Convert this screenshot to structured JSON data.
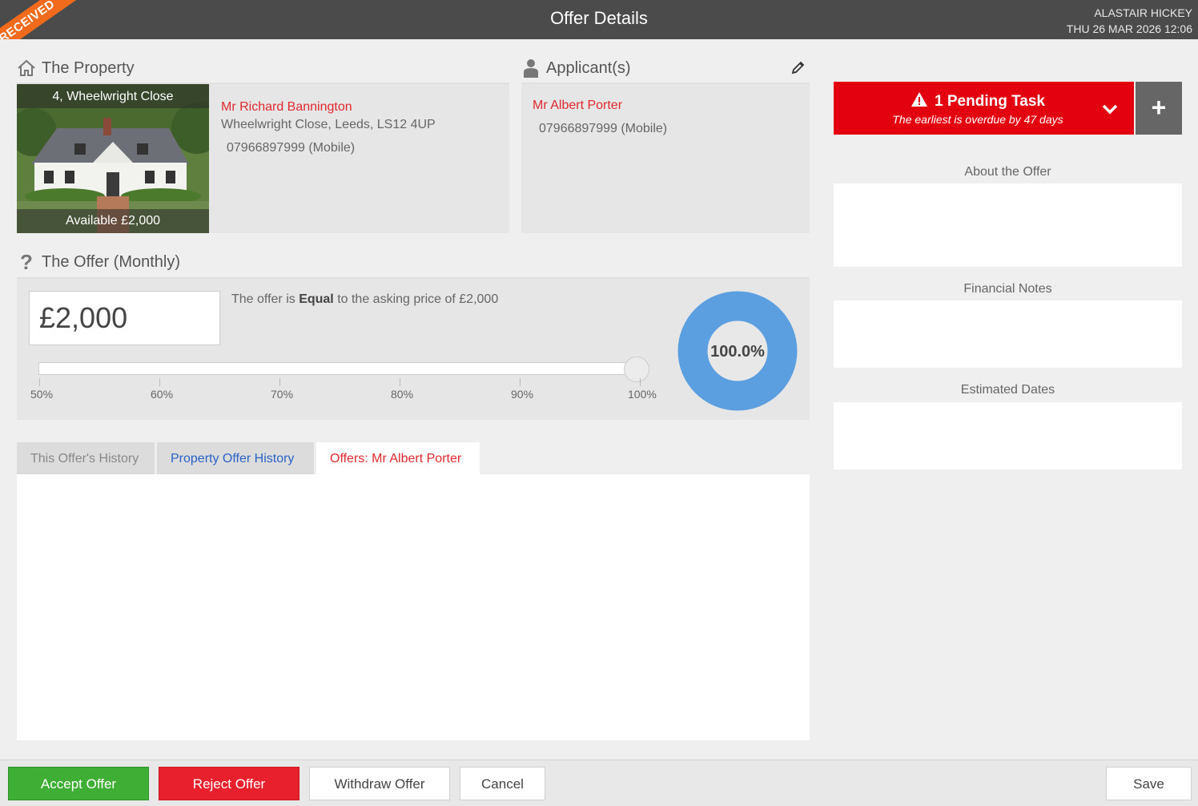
{
  "header": {
    "title": "Offer Details",
    "status_ribbon": "RECEIVED",
    "user_name": "ALASTAIR HICKEY",
    "datetime": "THU 26 MAR 2026 12:06"
  },
  "property": {
    "heading": "The Property",
    "address_caption": "4, Wheelwright Close",
    "availability_caption": "Available £2,000",
    "owner_name": "Mr Richard Bannington",
    "owner_address": "Wheelwright Close, Leeds, LS12 4UP",
    "owner_phone": "07966897999 (Mobile)"
  },
  "applicants": {
    "heading": "Applicant(s)",
    "name": "Mr Albert Porter",
    "phone": "07966897999 (Mobile)"
  },
  "offer": {
    "heading": "The Offer (Monthly)",
    "amount": "£2,000",
    "text_prefix": "The offer is ",
    "text_comparison": "Equal",
    "text_suffix": " to the asking price of £2,000",
    "slider_ticks": [
      "50%",
      "60%",
      "70%",
      "80%",
      "90%",
      "100%"
    ],
    "slider_value_percent": 100,
    "percentage_label": "100.0%",
    "donut_color": "#5b9fe0"
  },
  "tabs": [
    {
      "label": "This Offer's History"
    },
    {
      "label": "Property Offer History"
    },
    {
      "label": "Offers: Mr Albert Porter"
    }
  ],
  "tasks": {
    "title": "1 Pending Task",
    "subtitle": "The earliest is overdue by 47 days",
    "add_label": "+"
  },
  "notes": {
    "about_label": "About the Offer",
    "financial_label": "Financial Notes",
    "dates_label": "Estimated Dates"
  },
  "footer": {
    "accept": "Accept Offer",
    "reject": "Reject Offer",
    "withdraw": "Withdraw Offer",
    "cancel": "Cancel",
    "save": "Save"
  },
  "colors": {
    "header_bg": "#4b4b4b",
    "ribbon": "#f26a1b",
    "accent_red": "#e0282f",
    "accept_green": "#3fae34",
    "task_red": "#e3000f"
  }
}
